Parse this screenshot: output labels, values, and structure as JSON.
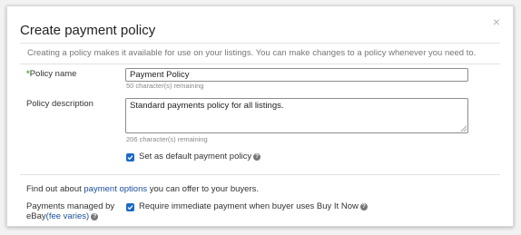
{
  "dialog": {
    "title": "Create payment policy",
    "close_symbol": "×",
    "intro": "Creating a policy makes it available for use on your listings. You can make changes to a policy whenever you need to."
  },
  "policy_name": {
    "required_mark": "*",
    "label": "Policy name",
    "value": "Payment Policy",
    "hint": "50 character(s) remaining"
  },
  "policy_description": {
    "label": "Policy description",
    "value": "Standard payments policy for all listings.",
    "hint": "206 character(s) remaining"
  },
  "default_policy": {
    "checked": true,
    "label": "Set as default payment policy",
    "help_icon": "?"
  },
  "payment_options": {
    "prefix": "Find out about ",
    "link": "payment options",
    "suffix": " you can offer to your buyers."
  },
  "managed_by_ebay": {
    "label_line1": "Payments managed by",
    "label_line2": "eBay",
    "fee_open": "(",
    "fee_link": "fee varies",
    "fee_close": ")",
    "help_icon": "?",
    "checkbox_checked": true,
    "checkbox_label": "Require immediate payment when buyer uses Buy It Now",
    "checkbox_help_icon": "?"
  },
  "colors": {
    "accent": "#1b6ac9",
    "link": "#1b4f9c",
    "required": "#5ba53e"
  }
}
